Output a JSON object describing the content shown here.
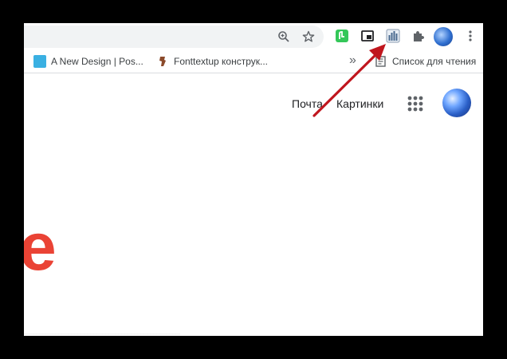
{
  "toolbar": {
    "icons": [
      "zoom-icon",
      "bookmark-star-icon",
      "extension-green-icon",
      "picture-in-picture-icon",
      "extension-stats-icon",
      "extensions-puzzle-icon",
      "profile-avatar",
      "more-menu-icon"
    ]
  },
  "bookmarks": {
    "items": [
      {
        "label": "A New Design | Pos..."
      },
      {
        "label": "Fonttextup конструк..."
      }
    ],
    "overflow": "»",
    "reading_list": "Список для чтения"
  },
  "page": {
    "links": [
      "Почта",
      "Картинки"
    ],
    "logo_fragment": "e"
  },
  "colors": {
    "accent": "#1a73e8",
    "logo_red": "#ea4335",
    "arrow_red": "#c0161e"
  }
}
